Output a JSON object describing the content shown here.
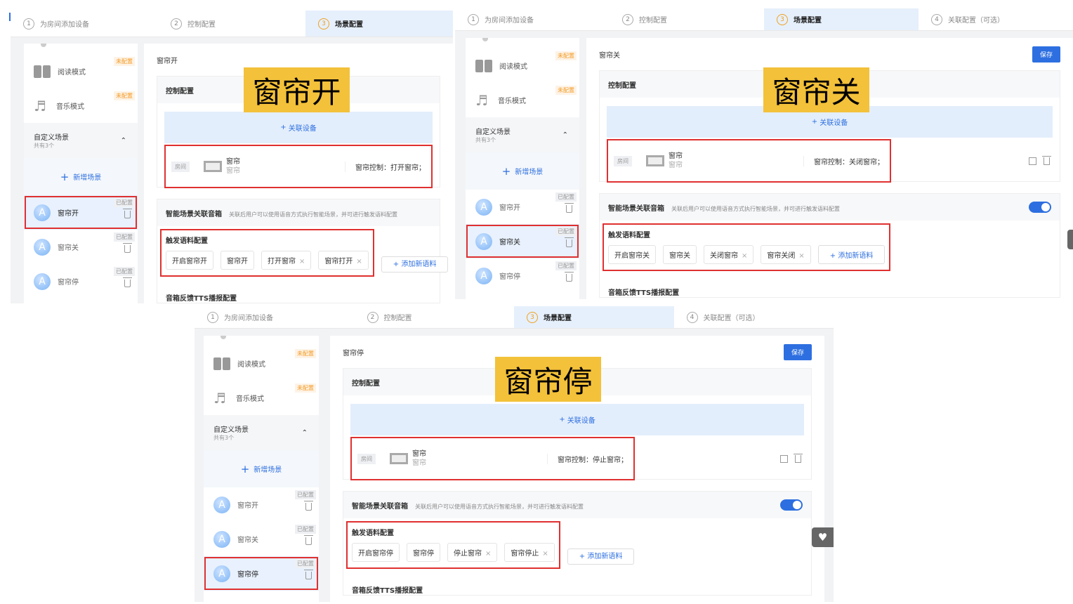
{
  "panels": [
    {
      "overlay": "窗帘开",
      "steps": [
        {
          "num": "1",
          "label": "为房间添加设备"
        },
        {
          "num": "2",
          "label": "控制配置"
        },
        {
          "num": "3",
          "label": "场景配置"
        }
      ],
      "active_step": 2,
      "sidebar": {
        "modes": [
          {
            "name": "阅读模式",
            "badge": "未配置",
            "icon": "book-icon"
          },
          {
            "name": "音乐模式",
            "badge": "未配置",
            "icon": "music-icon"
          }
        ],
        "group": {
          "title": "自定义场景",
          "count": "共有3个"
        },
        "add": "新增场景",
        "scenes": [
          {
            "name": "窗帘开",
            "badge": "已配置",
            "avatar": "A"
          },
          {
            "name": "窗帘关",
            "badge": "已配置",
            "avatar": "A"
          },
          {
            "name": "窗帘停",
            "badge": "已配置",
            "avatar": "A"
          }
        ],
        "selected": 0
      },
      "main": {
        "title": "窗帘开",
        "control_title": "控制配置",
        "add_device": "关联设备",
        "device": {
          "room": "房间",
          "name": "窗帘",
          "sub": "窗帘",
          "control": "窗帘控制：打开窗帘；"
        },
        "speaker_title": "智能场景关联音箱",
        "speaker_desc": "关联后用户可以使用语音方式执行智能场景，并可进行触发语料配置",
        "trigger_title": "触发语料配置",
        "chips": [
          {
            "text": "开启窗帘开",
            "removable": false
          },
          {
            "text": "窗帘开",
            "removable": false
          },
          {
            "text": "打开窗帘",
            "removable": true
          },
          {
            "text": "窗帘打开",
            "removable": true
          }
        ],
        "add_chip": "添加新语料",
        "tts": "音箱反馈TTS播报配置"
      }
    },
    {
      "overlay": "窗帘关",
      "steps": [
        {
          "num": "1",
          "label": "为房间添加设备"
        },
        {
          "num": "2",
          "label": "控制配置"
        },
        {
          "num": "3",
          "label": "场景配置"
        },
        {
          "num": "4",
          "label": "关联配置（可选）"
        }
      ],
      "active_step": 2,
      "sidebar": {
        "modes": [
          {
            "name": "阅读模式",
            "badge": "未配置",
            "icon": "book-icon"
          },
          {
            "name": "音乐模式",
            "badge": "未配置",
            "icon": "music-icon"
          }
        ],
        "group": {
          "title": "自定义场景",
          "count": "共有3个"
        },
        "add": "新增场景",
        "scenes": [
          {
            "name": "窗帘开",
            "badge": "已配置",
            "avatar": "A"
          },
          {
            "name": "窗帘关",
            "badge": "已配置",
            "avatar": "A"
          },
          {
            "name": "窗帘停",
            "badge": "已配置",
            "avatar": "A"
          }
        ],
        "selected": 1
      },
      "main": {
        "title": "窗帘关",
        "save": "保存",
        "control_title": "控制配置",
        "add_device": "关联设备",
        "device": {
          "room": "房间",
          "name": "窗帘",
          "sub": "窗帘",
          "control": "窗帘控制：关闭窗帘；"
        },
        "speaker_title": "智能场景关联音箱",
        "speaker_desc": "关联后用户可以使用语音方式执行智能场景，并可进行触发语料配置",
        "speaker_enabled": true,
        "trigger_title": "触发语料配置",
        "chips": [
          {
            "text": "开启窗帘关",
            "removable": false
          },
          {
            "text": "窗帘关",
            "removable": false
          },
          {
            "text": "关闭窗帘",
            "removable": true
          },
          {
            "text": "窗帘关闭",
            "removable": true
          }
        ],
        "add_chip": "添加新语料",
        "tts": "音箱反馈TTS播报配置"
      }
    },
    {
      "overlay": "窗帘停",
      "steps": [
        {
          "num": "1",
          "label": "为房间添加设备"
        },
        {
          "num": "2",
          "label": "控制配置"
        },
        {
          "num": "3",
          "label": "场景配置"
        },
        {
          "num": "4",
          "label": "关联配置（可选）"
        }
      ],
      "active_step": 2,
      "sidebar": {
        "modes": [
          {
            "name": "阅读模式",
            "badge": "未配置",
            "icon": "book-icon"
          },
          {
            "name": "音乐模式",
            "badge": "未配置",
            "icon": "music-icon"
          }
        ],
        "group": {
          "title": "自定义场景",
          "count": "共有3个"
        },
        "add": "新增场景",
        "scenes": [
          {
            "name": "窗帘开",
            "badge": "已配置",
            "avatar": "A"
          },
          {
            "name": "窗帘关",
            "badge": "已配置",
            "avatar": "A"
          },
          {
            "name": "窗帘停",
            "badge": "已配置",
            "avatar": "A"
          }
        ],
        "selected": 2
      },
      "main": {
        "title": "窗帘停",
        "save": "保存",
        "control_title": "控制配置",
        "add_device": "关联设备",
        "device": {
          "room": "房间",
          "name": "窗帘",
          "sub": "窗帘",
          "control": "窗帘控制：停止窗帘；"
        },
        "speaker_title": "智能场景关联音箱",
        "speaker_desc": "关联后用户可以使用语音方式执行智能场景，并可进行触发语料配置",
        "speaker_enabled": true,
        "trigger_title": "触发语料配置",
        "chips": [
          {
            "text": "开启窗帘停",
            "removable": false
          },
          {
            "text": "窗帘停",
            "removable": false
          },
          {
            "text": "停止窗帘",
            "removable": true
          },
          {
            "text": "窗帘停止",
            "removable": true
          }
        ],
        "add_chip": "添加新语料",
        "tts": "音箱反馈TTS播报配置"
      }
    }
  ],
  "fab_icon": "heart-icon"
}
